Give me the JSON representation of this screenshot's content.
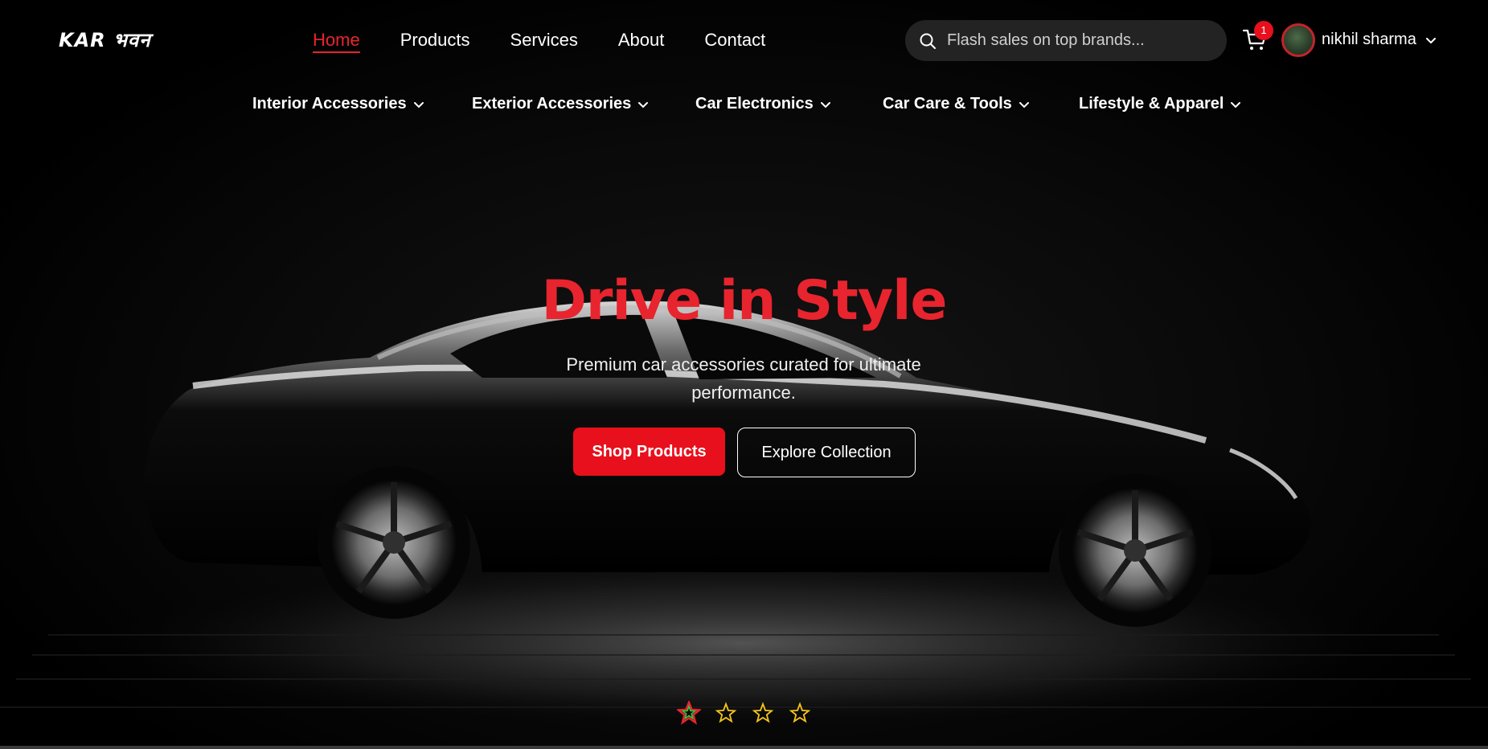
{
  "brand": {
    "logo": "KAR भवन"
  },
  "nav": {
    "links": [
      {
        "label": "Home",
        "active": true
      },
      {
        "label": "Products",
        "active": false
      },
      {
        "label": "Services",
        "active": false
      },
      {
        "label": "About",
        "active": false
      },
      {
        "label": "Contact",
        "active": false
      }
    ]
  },
  "search": {
    "placeholder": "Flash sales on top brands...",
    "value": ""
  },
  "cart": {
    "count": "1"
  },
  "user": {
    "name": "nikhil sharma"
  },
  "categories": [
    {
      "label": "Interior Accessories"
    },
    {
      "label": "Exterior Accessories"
    },
    {
      "label": "Car Electronics"
    },
    {
      "label": "Car Care & Tools"
    },
    {
      "label": "Lifestyle & Apparel"
    }
  ],
  "hero": {
    "title": "Drive in Style",
    "subtitle": "Premium car accessories curated for ultimate performance.",
    "primary_cta": "Shop Products",
    "secondary_cta": "Explore Collection",
    "slides": 4,
    "active_slide": 1
  },
  "colors": {
    "accent": "#e8242e",
    "button": "#e8101c",
    "search_bg": "#232323",
    "page_bg": "#000000"
  }
}
